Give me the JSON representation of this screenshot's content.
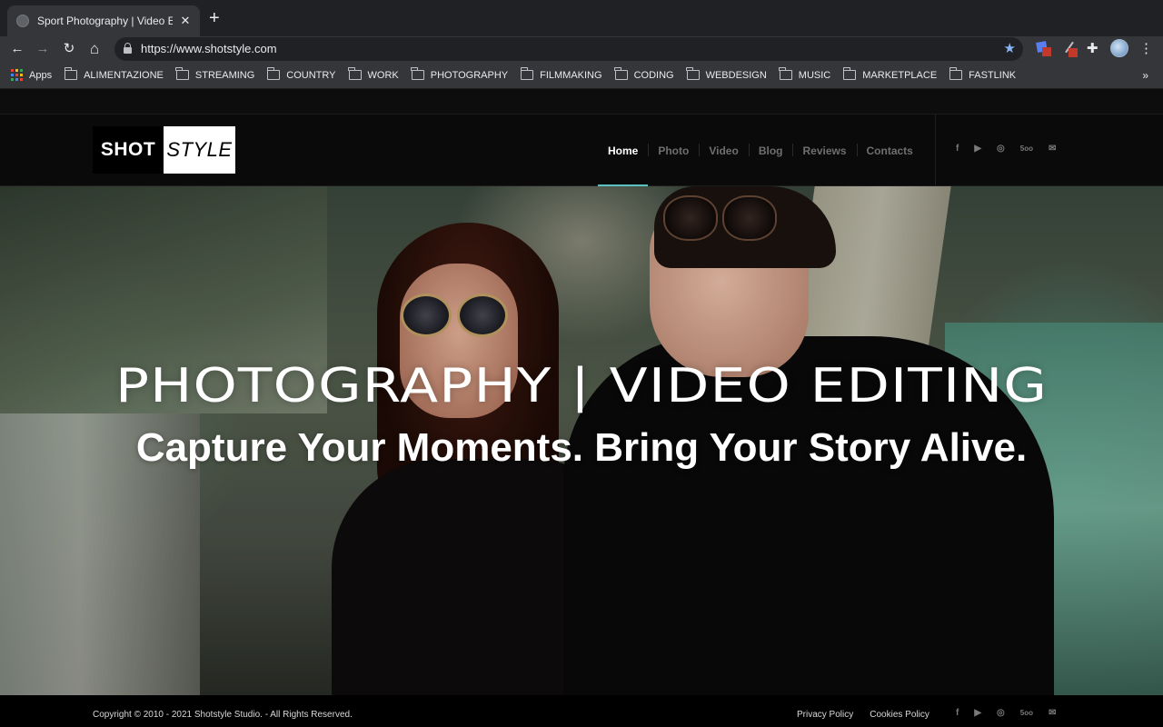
{
  "browser": {
    "tab_title": "Sport Photography | Video Editi",
    "tab_close": "✕",
    "new_tab": "+",
    "url": "https://www.shotstyle.com",
    "nav": {
      "back": "←",
      "forward": "→",
      "reload": "↻",
      "home": "⌂"
    },
    "star": "★",
    "extensions_icon": "✚",
    "menu_icon": "⋮",
    "bookmarks": [
      {
        "label": "Apps",
        "icon": "apps-grid"
      },
      {
        "label": "ALIMENTAZIONE",
        "icon": "folder"
      },
      {
        "label": "STREAMING",
        "icon": "folder"
      },
      {
        "label": "COUNTRY",
        "icon": "folder"
      },
      {
        "label": "WORK",
        "icon": "folder"
      },
      {
        "label": "PHOTOGRAPHY",
        "icon": "folder"
      },
      {
        "label": "FILMMAKING",
        "icon": "folder"
      },
      {
        "label": "CODING",
        "icon": "folder"
      },
      {
        "label": "WEBDESIGN",
        "icon": "folder"
      },
      {
        "label": "MUSIC",
        "icon": "folder"
      },
      {
        "label": "MARKETPLACE",
        "icon": "folder"
      },
      {
        "label": "FASTLINK",
        "icon": "folder"
      }
    ],
    "bookmarks_more": "»"
  },
  "site": {
    "logo": {
      "left": "SHOT",
      "right": "STYLE"
    },
    "nav": [
      {
        "label": "Home",
        "active": true
      },
      {
        "label": "Photo",
        "active": false
      },
      {
        "label": "Video",
        "active": false
      },
      {
        "label": "Blog",
        "active": false
      },
      {
        "label": "Reviews",
        "active": false
      },
      {
        "label": "Contacts",
        "active": false
      }
    ],
    "social": [
      {
        "name": "facebook-icon",
        "glyph": "f"
      },
      {
        "name": "youtube-icon",
        "glyph": "▶"
      },
      {
        "name": "instagram-icon",
        "glyph": "◎"
      },
      {
        "name": "500px-icon",
        "glyph": "5oo"
      },
      {
        "name": "mail-icon",
        "glyph": "✉"
      }
    ],
    "hero": {
      "title": "PHOTOGRAPHY | VIDEO EDITING",
      "subtitle": "Capture Your Moments. Bring Your Story Alive."
    },
    "footer": {
      "copyright": "Copyright © 2010 - 2021 Shotstyle Studio. - All Rights Reserved.",
      "links": [
        "Privacy Policy",
        "Cookies Policy"
      ]
    },
    "accent_color": "#5bc0c0"
  }
}
